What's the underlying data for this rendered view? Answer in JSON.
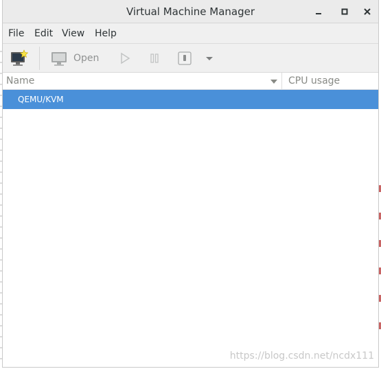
{
  "window": {
    "title": "Virtual Machine Manager"
  },
  "menubar": {
    "items": [
      "File",
      "Edit",
      "View",
      "Help"
    ]
  },
  "toolbar": {
    "open_label": "Open"
  },
  "columns": {
    "name": "Name",
    "cpu": "CPU usage"
  },
  "rows": [
    {
      "label": "QEMU/KVM",
      "selected": true
    }
  ],
  "watermark": "https://blog.csdn.net/ncdx111",
  "colors": {
    "selection": "#4a90d9",
    "titlebar": "#ebebeb"
  }
}
